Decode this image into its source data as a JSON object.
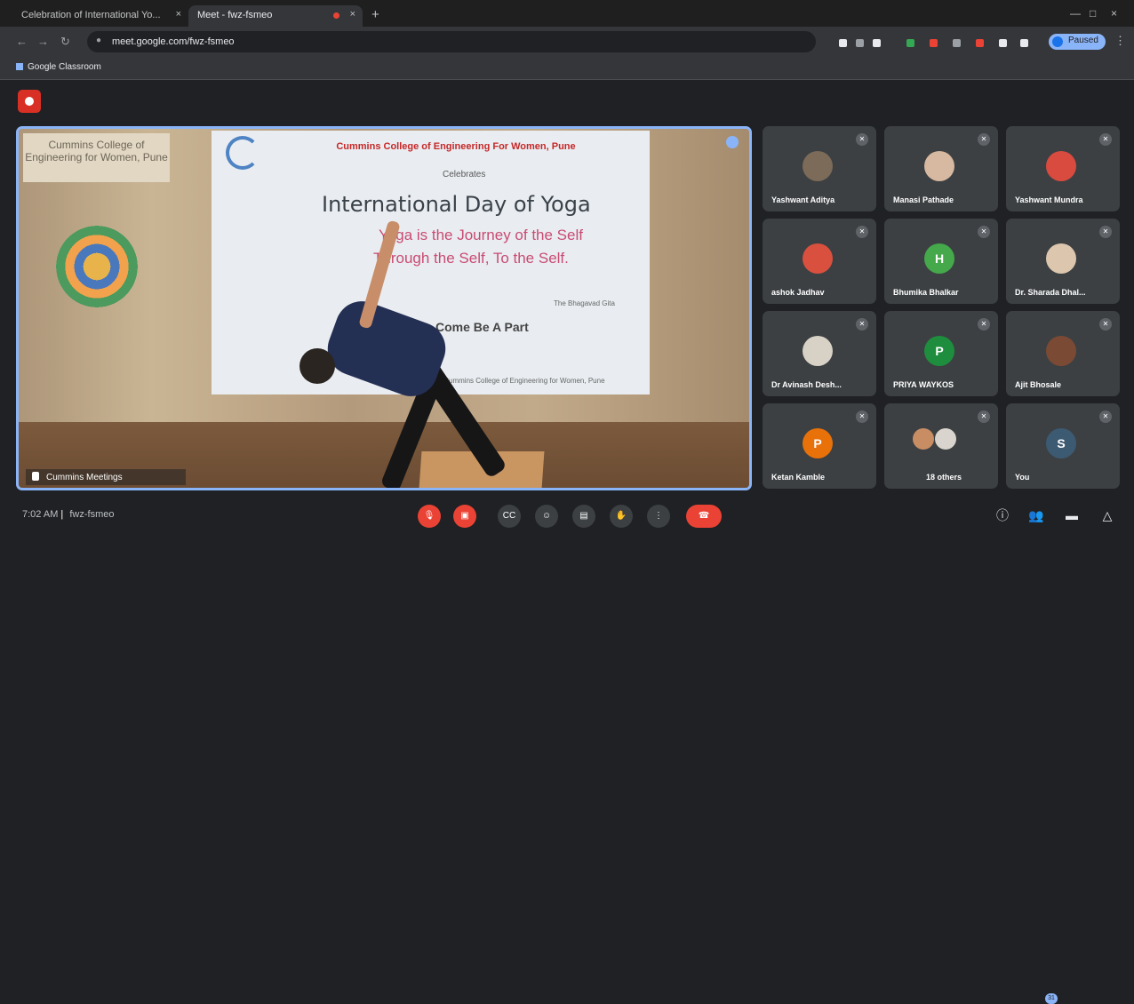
{
  "browser": {
    "tabs": [
      {
        "title": "Celebration of International Yo...",
        "active": false
      },
      {
        "title": "Meet - fwz-fsmeo",
        "active": true
      }
    ],
    "address": "meet.google.com/fwz-fsmeo",
    "bookmark": "Google Classroom",
    "profile": "Paused"
  },
  "video": {
    "speaker": "Cummins Meetings",
    "banner_left": "Cummins College of Engineering for Women, Pune",
    "college": "Cummins College of Engineering For Women, Pune",
    "celebrates": "Celebrates",
    "title": "International Day of Yoga",
    "quote_1": "Yoga is the Journey of the Self",
    "quote_2": "Through the Self, To the Self.",
    "quote_source": "The Bhagavad Gita",
    "part": "Come Be A Part",
    "footer": "21st June 2023 | Cummins College of Engineering for Women, Pune"
  },
  "participants": [
    {
      "name": "Yashwant Aditya",
      "avatar": "photo",
      "color": "#7c6b58"
    },
    {
      "name": "Manasi Pathade",
      "avatar": "photo",
      "color": "#d7b8a0"
    },
    {
      "name": "Yashwant Mundra",
      "avatar": "photo",
      "color": "#d94b3f"
    },
    {
      "name": "ashok Jadhav",
      "avatar": "photo",
      "color": "#d9503f"
    },
    {
      "name": "Bhumika Bhalkar",
      "avatar": "H",
      "color": "#45a84b"
    },
    {
      "name": "Dr. Sharada Dhal...",
      "avatar": "photo",
      "color": "#dcc6ad"
    },
    {
      "name": "Dr Avinash Desh...",
      "avatar": "photo",
      "color": "#d8d2c6"
    },
    {
      "name": "PRIYA WAYKOS",
      "avatar": "P",
      "color": "#1e8e3e"
    },
    {
      "name": "Ajit Bhosale",
      "avatar": "photo",
      "color": "#7b4a34"
    },
    {
      "name": "Ketan Kamble",
      "avatar": "P",
      "color": "#e8710a"
    },
    {
      "name": "18 others",
      "avatar": "photo",
      "color": "#c98d64"
    },
    {
      "name": "You",
      "avatar": "S",
      "color": "#3d5a73"
    }
  ],
  "meeting": {
    "time": "7:02 AM",
    "code": "fwz-fsmeo",
    "people_count": "31"
  },
  "controls": [
    "mic-off",
    "camera-off",
    "captions",
    "emoji",
    "present",
    "raise-hand",
    "more-options",
    "leave"
  ]
}
